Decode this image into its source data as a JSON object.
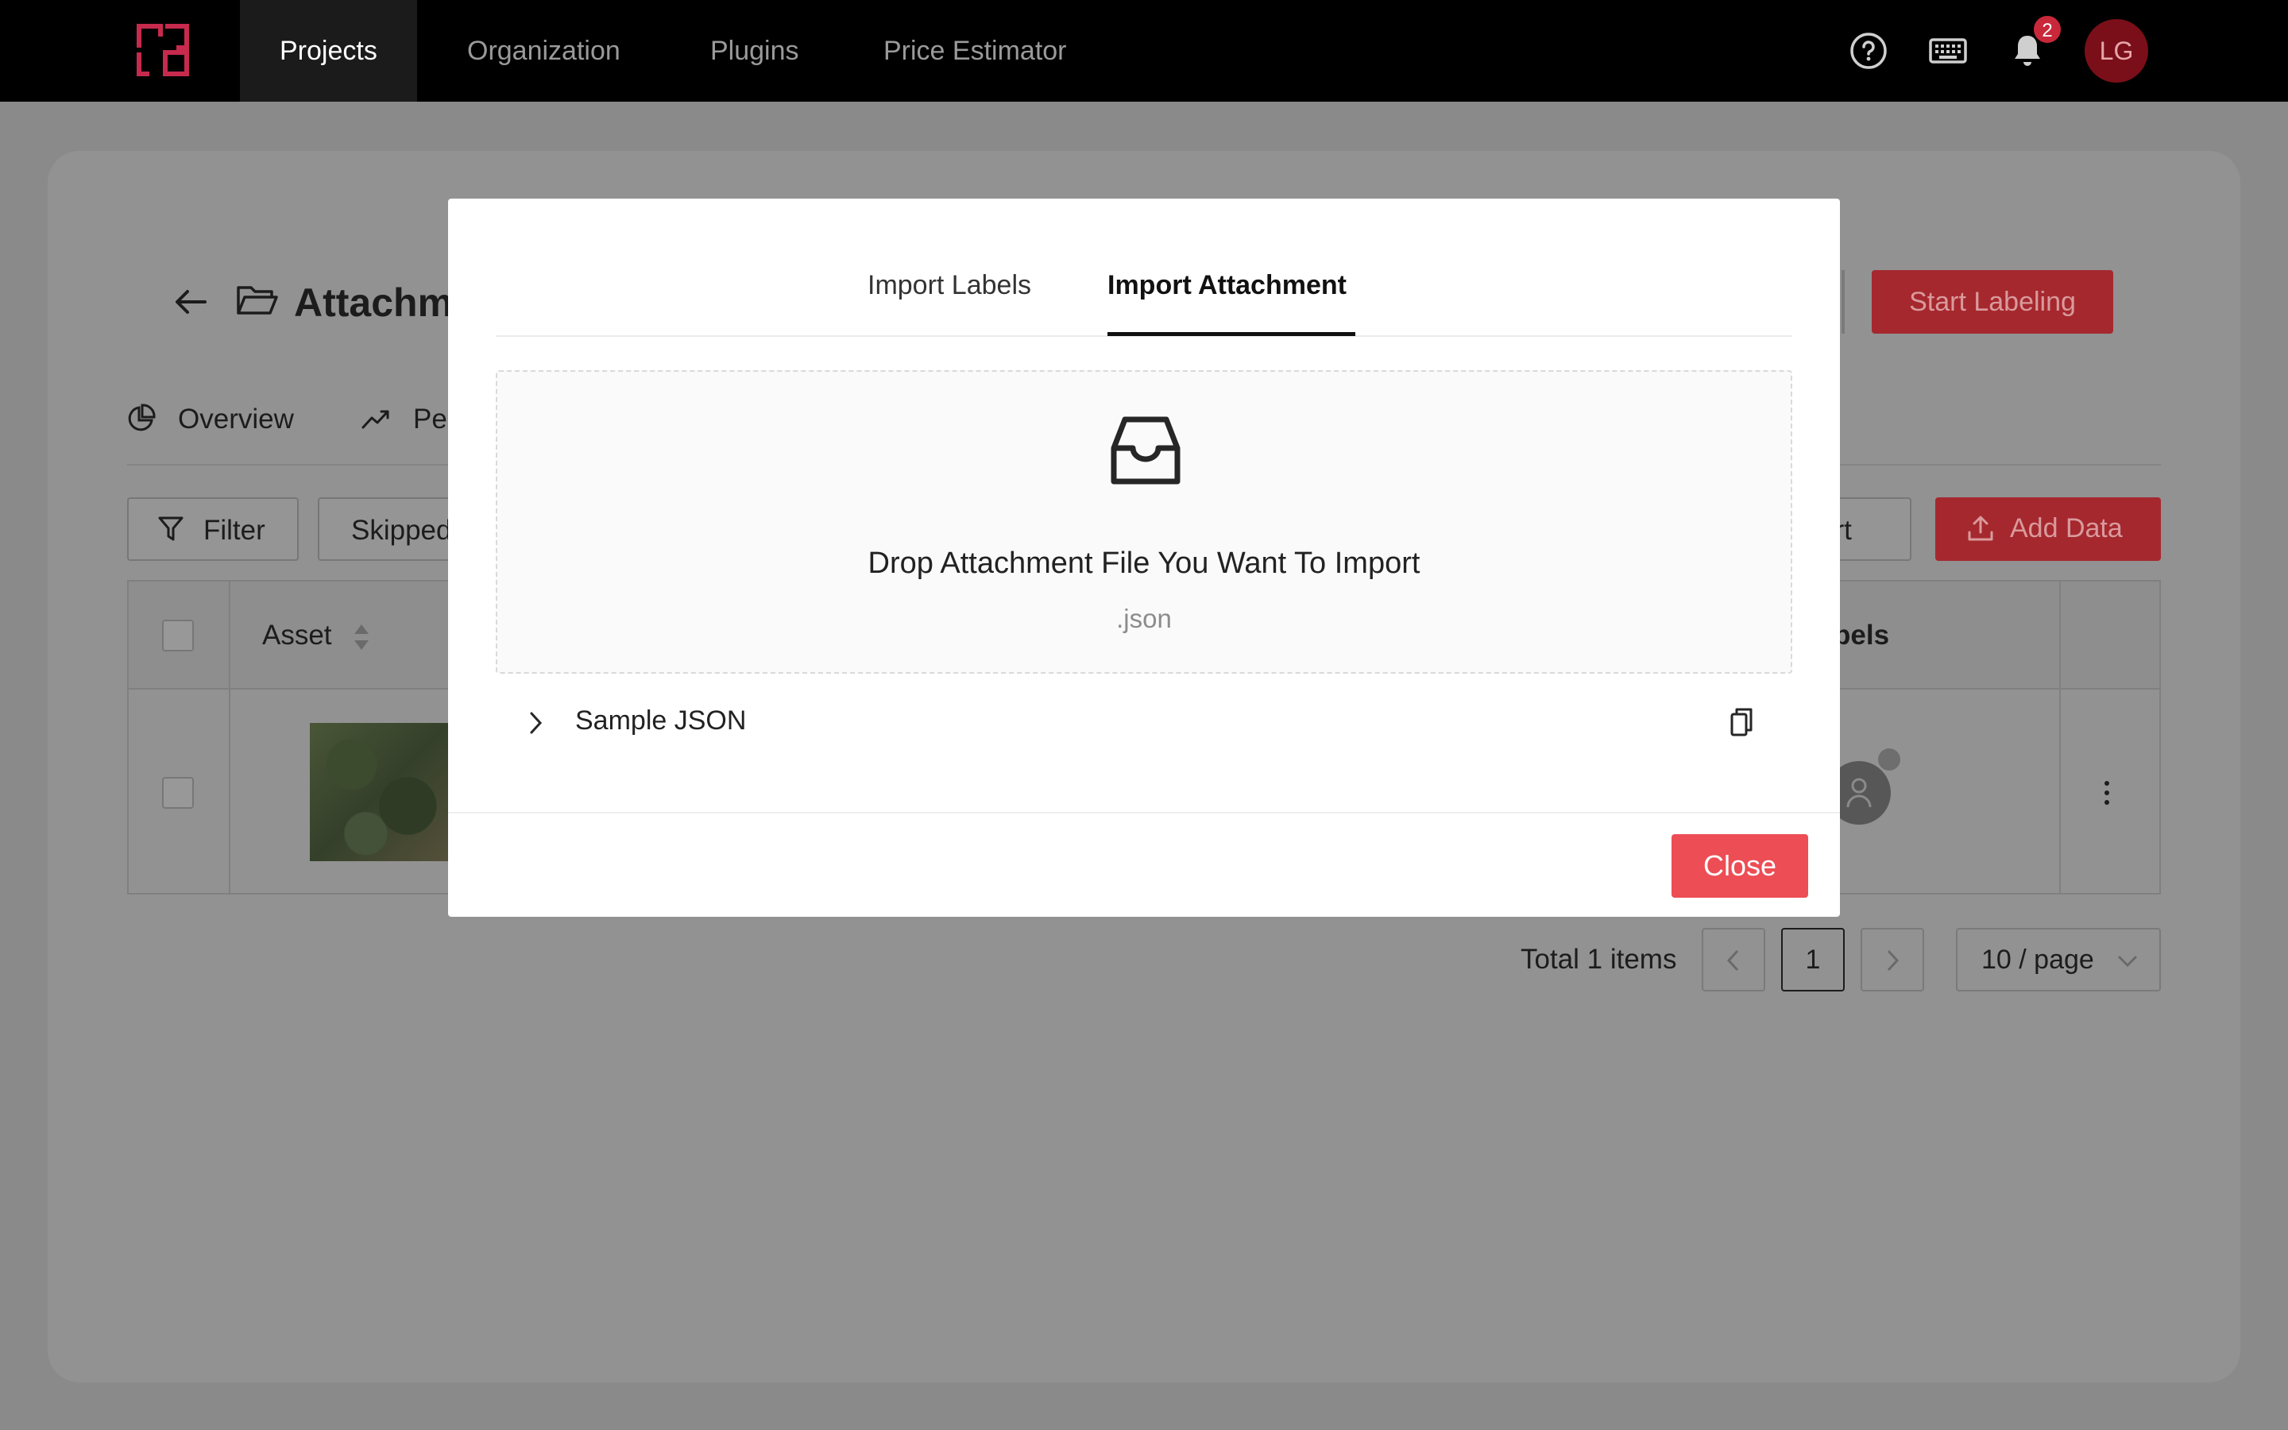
{
  "topnav": {
    "items": [
      {
        "label": "Projects",
        "active": true
      },
      {
        "label": "Organization"
      },
      {
        "label": "Plugins"
      },
      {
        "label": "Price Estimator"
      }
    ],
    "icons": [
      "help-icon",
      "keyboard-icon",
      "bell-icon"
    ],
    "notification_count": "2",
    "avatar_initials": "LG",
    "colors": {
      "bar": "#000000",
      "logo": "#c62a4d",
      "badge": "#c8283a",
      "avatar": "#7a0f19"
    }
  },
  "page": {
    "title": "Attachm",
    "tabs": [
      {
        "label": "Overview",
        "icon": "pie-chart-icon"
      },
      {
        "label": "Pe",
        "icon": "trend-icon"
      }
    ],
    "filter_label": "Filter",
    "skipped_label": "Skipped",
    "export_label": "ort",
    "add_data_label": "Add Data",
    "start_labeling_label": "Start Labeling",
    "table": {
      "columns": [
        "Asset",
        "bels"
      ]
    },
    "pagination": {
      "total": "Total 1 items",
      "current_page": "1",
      "page_size": "10 / page"
    }
  },
  "modal": {
    "tabs": [
      {
        "label": "Import Labels"
      },
      {
        "label": "Import Attachment",
        "active": true
      }
    ],
    "dropzone": {
      "icon": "inbox-icon",
      "title": "Drop Attachment File You Want To Import",
      "hint": ".json"
    },
    "sample": {
      "label": "Sample JSON",
      "icon": "copy-icon"
    },
    "close_label": "Close",
    "colors": {
      "close": "#ed4d55"
    }
  }
}
